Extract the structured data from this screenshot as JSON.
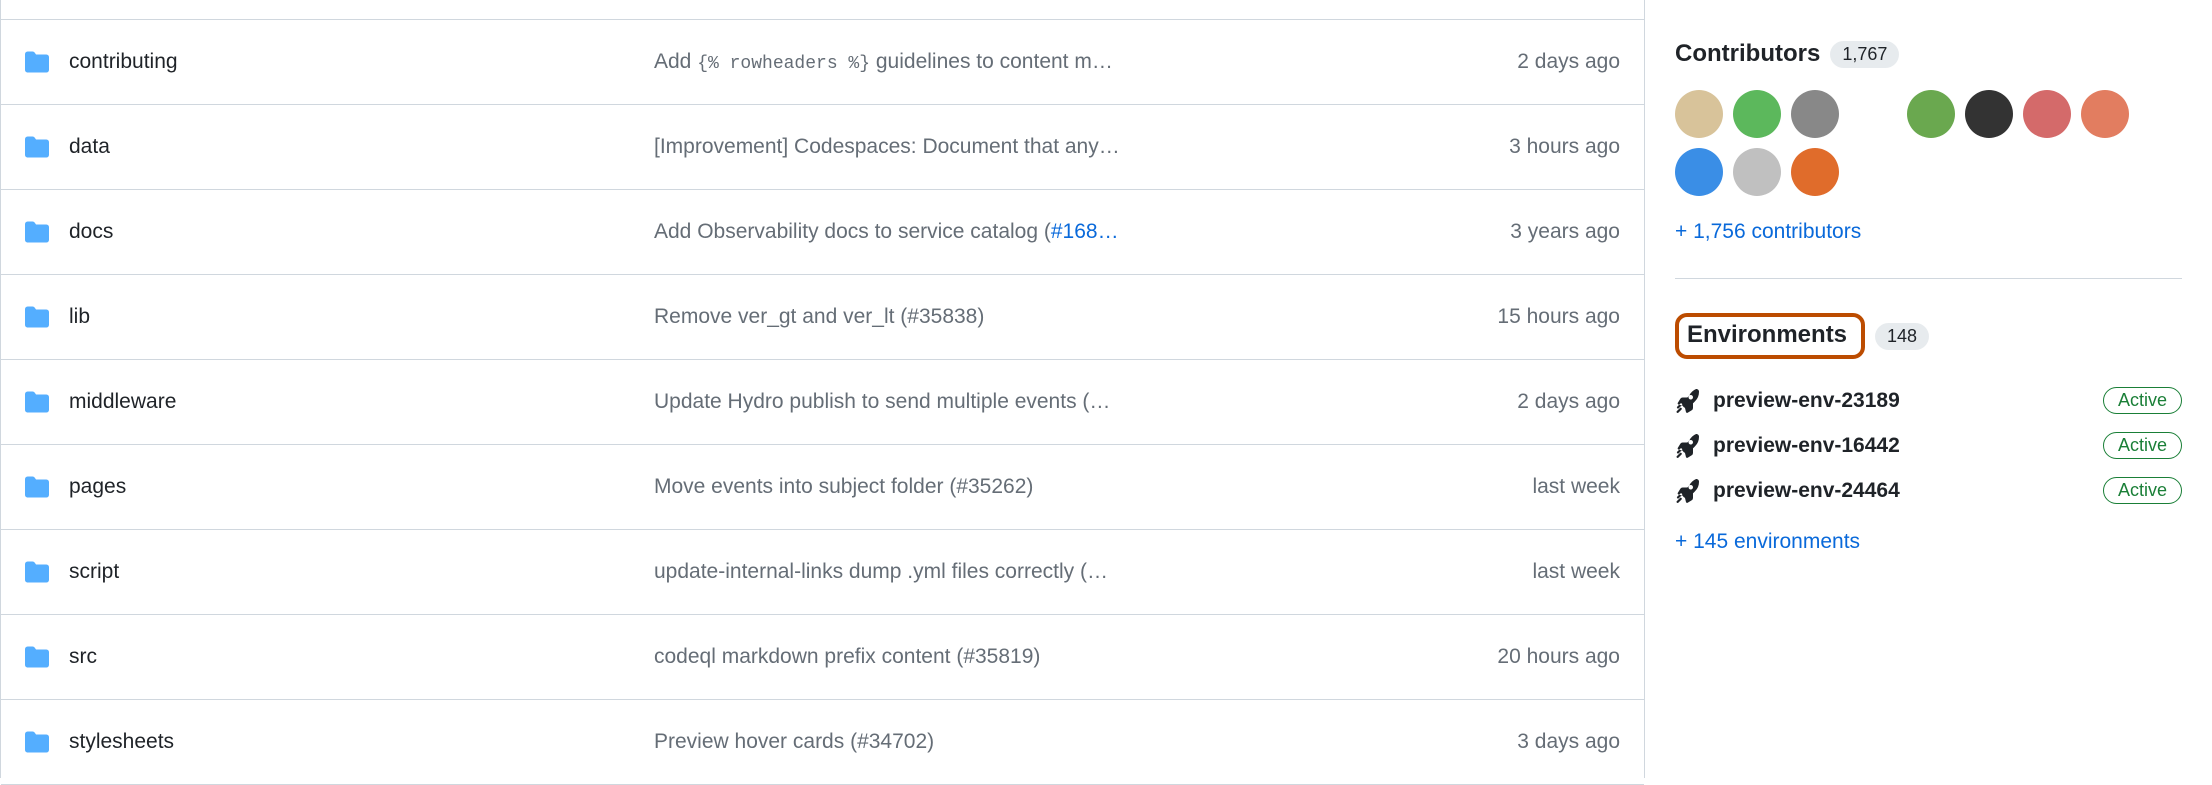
{
  "files": [
    {
      "name": "contributing",
      "commit_parts": [
        {
          "t": "text",
          "v": "Add "
        },
        {
          "t": "code",
          "v": "{% rowheaders %}"
        },
        {
          "t": "text",
          "v": " guidelines to content m…"
        }
      ],
      "time": "2 days ago"
    },
    {
      "name": "data",
      "commit_parts": [
        {
          "t": "text",
          "v": "[Improvement] Codespaces: Document that any…"
        }
      ],
      "time": "3 hours ago"
    },
    {
      "name": "docs",
      "commit_parts": [
        {
          "t": "text",
          "v": "Add Observability docs to service catalog ("
        },
        {
          "t": "link",
          "v": "#168…"
        }
      ],
      "time": "3 years ago"
    },
    {
      "name": "lib",
      "commit_parts": [
        {
          "t": "text",
          "v": "Remove ver_gt and ver_lt (#35838)"
        }
      ],
      "time": "15 hours ago"
    },
    {
      "name": "middleware",
      "commit_parts": [
        {
          "t": "text",
          "v": "Update Hydro publish to send multiple events (…"
        }
      ],
      "time": "2 days ago"
    },
    {
      "name": "pages",
      "commit_parts": [
        {
          "t": "text",
          "v": "Move events into subject folder (#35262)"
        }
      ],
      "time": "last week"
    },
    {
      "name": "script",
      "commit_parts": [
        {
          "t": "text",
          "v": "update-internal-links dump .yml files correctly (…"
        }
      ],
      "time": "last week"
    },
    {
      "name": "src",
      "commit_parts": [
        {
          "t": "text",
          "v": "codeql markdown prefix content (#35819)"
        }
      ],
      "time": "20 hours ago"
    },
    {
      "name": "stylesheets",
      "commit_parts": [
        {
          "t": "text",
          "v": "Preview hover cards (#34702)"
        }
      ],
      "time": "3 days ago"
    }
  ],
  "contributors": {
    "title": "Contributors",
    "count": "1,767",
    "avatar_colors": [
      "#d8c39a",
      "#5cb85c",
      "#888888",
      "#ffffff",
      "#6aa84f",
      "#333333",
      "#d46a6a",
      "#e27d60",
      "#3a8ee6",
      "#c0c0c0",
      "#e06c2b"
    ],
    "more_link": "+ 1,756 contributors"
  },
  "environments": {
    "title": "Environments",
    "count": "148",
    "items": [
      {
        "name": "preview-env-23189",
        "status": "Active"
      },
      {
        "name": "preview-env-16442",
        "status": "Active"
      },
      {
        "name": "preview-env-24464",
        "status": "Active"
      }
    ],
    "more_link": "+ 145 environments"
  }
}
